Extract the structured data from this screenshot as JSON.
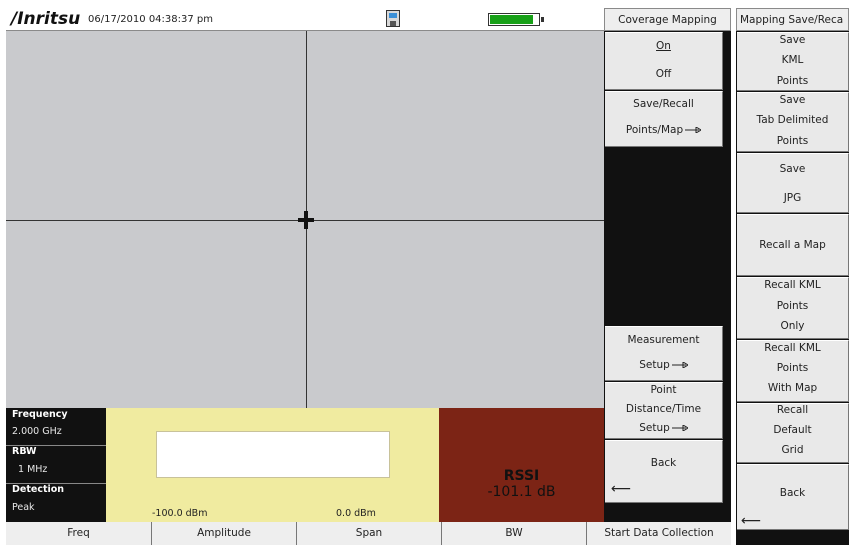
{
  "top_bar": {
    "brand": "/Inritsu",
    "datetime": "06/17/2010 04:38:37 pm",
    "battery_level": 0.9,
    "battery_color": "#17a017"
  },
  "info": {
    "frequency_label": "Frequency",
    "frequency_value": "2.000 GHz",
    "rbw_label": "RBW",
    "rbw_value": "1 MHz",
    "detection_label": "Detection",
    "detection_value": "Peak"
  },
  "scale": {
    "min": "-100.0 dBm",
    "max": "0.0 dBm"
  },
  "rssi": {
    "label": "RSSI",
    "value": "-101.1 dB",
    "panel_color": "#7c2415"
  },
  "bottom_keys": [
    "Freq",
    "Amplitude",
    "Span",
    "BW",
    "Start Data Collection"
  ],
  "menu1": {
    "title": "Coverage Mapping",
    "keys": [
      {
        "lines": [
          "On",
          "Off"
        ]
      },
      {
        "lines": [
          "Save/Recall",
          "Points/Map"
        ]
      },
      {
        "lines": [
          "Measurement",
          "Setup"
        ]
      },
      {
        "lines": [
          "Point",
          "Distance/Time",
          "Setup"
        ]
      },
      {
        "lines": [
          "Back"
        ]
      }
    ]
  },
  "menu2": {
    "title": "Mapping Save/Reca",
    "keys": [
      {
        "lines": [
          "Save",
          "KML",
          "Points"
        ]
      },
      {
        "lines": [
          "Save",
          "Tab Delimited",
          "Points"
        ]
      },
      {
        "lines": [
          "Save",
          "JPG"
        ]
      },
      {
        "lines": [
          "Recall a Map"
        ]
      },
      {
        "lines": [
          "Recall KML",
          "Points",
          "Only"
        ]
      },
      {
        "lines": [
          "Recall KML",
          "Points",
          "With Map"
        ]
      },
      {
        "lines": [
          "Recall",
          "Default",
          "Grid"
        ]
      },
      {
        "lines": [
          "Back"
        ]
      }
    ]
  },
  "icons": {
    "save_status": "floppy-disk-icon",
    "battery": "battery-icon",
    "cursor": "crosshair-cursor-icon",
    "submenu_arrow": "submenu-arrow-icon",
    "back_arrow": "back-arrow-icon"
  },
  "colors": {
    "map_background": "#c9cacd",
    "scale_panel": "#f0eba0",
    "softkey_panel": "#111111"
  }
}
